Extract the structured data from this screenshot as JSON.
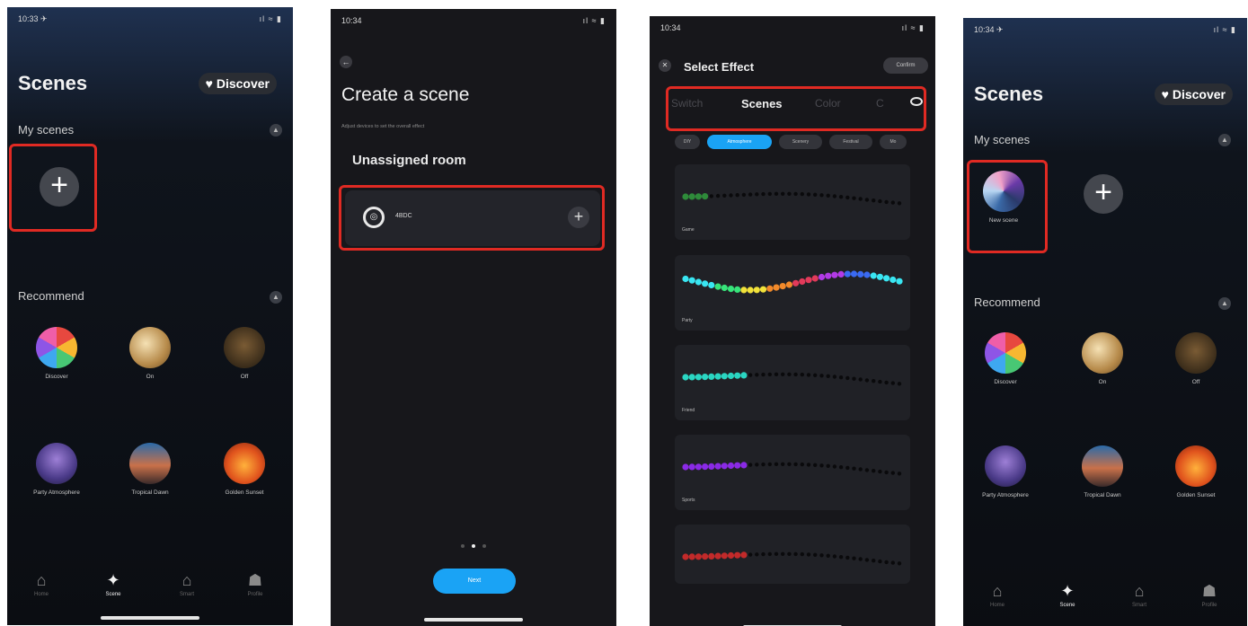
{
  "screen1": {
    "status_time": "10:33 ✈",
    "status_sys": "ıl ≈ ▮",
    "title": "Scenes",
    "discover_label": "♥ Discover",
    "my_scenes_label": "My scenes",
    "recommend_label": "Recommend",
    "recommend": [
      {
        "label": "Discover"
      },
      {
        "label": "On"
      },
      {
        "label": "Off"
      },
      {
        "label": "Party Atmosphere"
      },
      {
        "label": "Tropical Dawn"
      },
      {
        "label": "Golden Sunset"
      }
    ],
    "tabs": [
      {
        "label": "Home",
        "icon": "home-icon"
      },
      {
        "label": "Scene",
        "icon": "magic-wand-icon"
      },
      {
        "label": "Smart",
        "icon": "smart-icon"
      },
      {
        "label": "Profile",
        "icon": "profile-icon"
      }
    ]
  },
  "screen2": {
    "status_time": "10:34",
    "status_sys": "ıl ≈ ▮",
    "title": "Create a scene",
    "subtitle": "Adjust devices to set the overall effect",
    "room": "Unassigned room",
    "device_name": "4BDC",
    "next_label": "Next"
  },
  "screen3": {
    "status_time": "10:34",
    "status_sys": "ıl ≈ ▮",
    "title": "Select Effect",
    "confirm_label": "Confirm",
    "tabs": [
      "Switch",
      "Scenes",
      "Color",
      "C"
    ],
    "chips": [
      "DIY",
      "Atmosphere",
      "Scenery",
      "Festival",
      "Mo"
    ],
    "effects": [
      {
        "label": "Game",
        "colors": [
          "#2e8b3a"
        ]
      },
      {
        "label": "Party",
        "colors": [
          "#39e6f2",
          "#37e47a",
          "#f2e23a",
          "#f28a2a",
          "#e23a5a",
          "#b23ae6",
          "#3a6af2",
          "#39e6f2"
        ]
      },
      {
        "label": "Friend",
        "colors": [
          "#2ad6c2"
        ]
      },
      {
        "label": "Sports",
        "colors": [
          "#8a2ae6"
        ]
      },
      {
        "label": "",
        "colors": [
          "#c22a2a"
        ]
      }
    ]
  },
  "screen4": {
    "status_time": "10:34 ✈",
    "status_sys": "ıl ≈ ▮",
    "title": "Scenes",
    "discover_label": "♥ Discover",
    "my_scenes_label": "My scenes",
    "new_scene_label": "New scene",
    "recommend_label": "Recommend",
    "recommend": [
      {
        "label": "Discover"
      },
      {
        "label": "On"
      },
      {
        "label": "Off"
      },
      {
        "label": "Party Atmosphere"
      },
      {
        "label": "Tropical Dawn"
      },
      {
        "label": "Golden Sunset"
      }
    ],
    "tabs": [
      {
        "label": "Home",
        "icon": "home-icon"
      },
      {
        "label": "Scene",
        "icon": "magic-wand-icon"
      },
      {
        "label": "Smart",
        "icon": "smart-icon"
      },
      {
        "label": "Profile",
        "icon": "profile-icon"
      }
    ]
  },
  "colors": {
    "highlight": "#e02a23",
    "accent": "#1aa3f5"
  }
}
